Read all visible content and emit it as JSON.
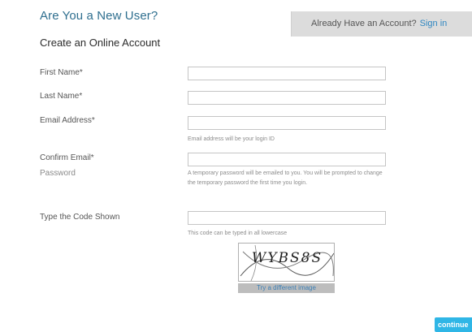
{
  "header": {
    "new_user_heading": "Are You a New User?",
    "have_account_text": "Already Have an Account?",
    "sign_in_link": "Sign in"
  },
  "form": {
    "title": "Create an Online Account",
    "fields": {
      "first_name": {
        "label": "First Name*",
        "value": ""
      },
      "last_name": {
        "label": "Last Name*",
        "value": ""
      },
      "email": {
        "label": "Email Address*",
        "value": "",
        "hint": "Email address will be your login ID"
      },
      "confirm_email": {
        "label": "Confirm Email*",
        "value": ""
      },
      "password": {
        "label": "Password",
        "hint": "A temporary password will be emailed to you. You will be prompted to change the temporary password the first time you login."
      },
      "captcha_code": {
        "label": "Type the Code Shown",
        "value": "",
        "hint": "This code can be typed in all lowercase"
      }
    },
    "captcha": {
      "image_text": "WYBS8S",
      "refresh_link": "Try a different image"
    },
    "continue_label": "continue"
  },
  "colors": {
    "heading": "#2f6f8f",
    "link": "#2e86c1",
    "panel_bg": "#dcdcdc",
    "button": "#2fb6e6"
  }
}
